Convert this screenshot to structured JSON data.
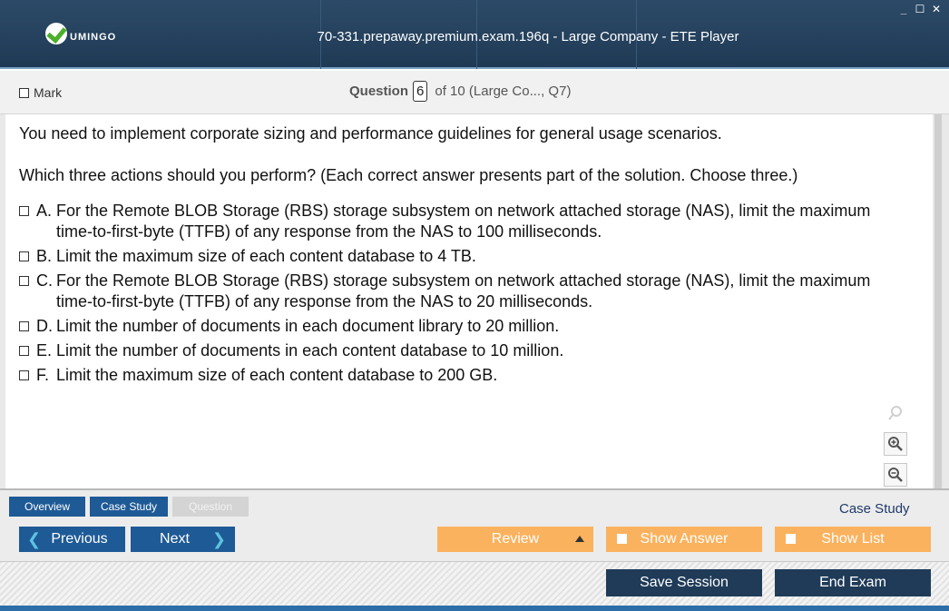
{
  "window": {
    "logo_text": "UMINGO",
    "title": "70-331.prepaway.premium.exam.196q - Large Company - ETE Player",
    "controls": {
      "minimize": "_",
      "maximize": "☐",
      "close": "✕"
    }
  },
  "question_header": {
    "mark_label": "Mark",
    "question_label": "Question",
    "question_number": "6",
    "of_text": "of 10 (Large Co..., Q7)"
  },
  "question": {
    "text1": "You need to implement corporate sizing and performance guidelines for general usage scenarios.",
    "text2": "Which three actions should you perform? (Each correct answer presents part of the solution. Choose three.)",
    "options": [
      {
        "letter": "A.",
        "text": "For the Remote BLOB Storage (RBS) storage subsystem on network attached storage (NAS), limit the maximum time-to-first-byte (TTFB) of any response from the NAS to 100 milliseconds."
      },
      {
        "letter": "B.",
        "text": "Limit the maximum size of each content database to 4 TB."
      },
      {
        "letter": "C.",
        "text": "For the Remote BLOB Storage (RBS) storage subsystem on network attached storage (NAS), limit the maximum time-to-first-byte (TTFB) of any response from the NAS to 20 milliseconds."
      },
      {
        "letter": "D.",
        "text": "Limit the number of documents in each document library to 20 million."
      },
      {
        "letter": "E.",
        "text": "Limit the number of documents in each content database to 10 million."
      },
      {
        "letter": "F.",
        "text": "Limit the maximum size of each content database to 200 GB."
      }
    ]
  },
  "tabs": {
    "overview": "Overview",
    "case_study": "Case Study",
    "question": "Question",
    "section_label": "Case Study"
  },
  "nav": {
    "previous": "Previous",
    "next": "Next",
    "review": "Review",
    "show_answer": "Show Answer",
    "show_list": "Show List",
    "prev_arrow": "❮",
    "next_arrow": "❯"
  },
  "footer": {
    "save_session": "Save Session",
    "end_exam": "End Exam"
  },
  "colors": {
    "titlebar": "#1f3a55",
    "blue_button": "#1e5a96",
    "orange_button": "#fbb25e",
    "dark_button": "#1f3b58"
  }
}
